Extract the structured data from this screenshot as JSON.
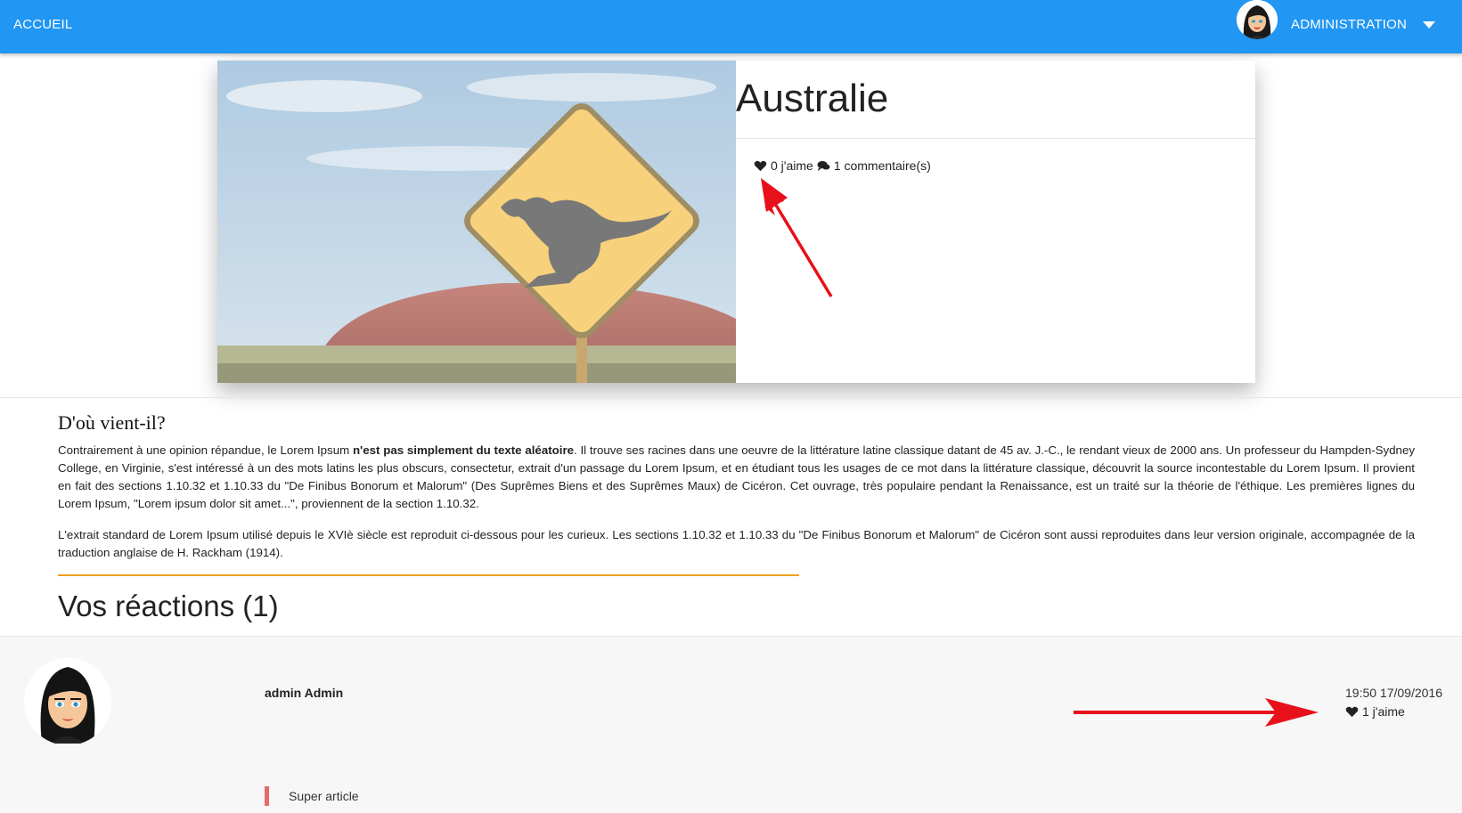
{
  "navbar": {
    "home_label": "ACCUEIL",
    "admin_label": "ADMINISTRATION"
  },
  "post": {
    "title": "Australie",
    "likes_label": "0 j'aime",
    "comments_label": "1 commentaire(s)"
  },
  "article": {
    "heading": "D'où vient-il?",
    "p1_before": "Contrairement à une opinion répandue, le Lorem Ipsum ",
    "p1_bold": "n'est pas simplement du texte aléatoire",
    "p1_after": ". Il trouve ses racines dans une oeuvre de la littérature latine classique datant de 45 av. J.-C., le rendant vieux de 2000 ans. Un professeur du Hampden-Sydney College, en Virginie, s'est intéressé à un des mots latins les plus obscurs, consectetur, extrait d'un passage du Lorem Ipsum, et en étudiant tous les usages de ce mot dans la littérature classique, découvrit la source incontestable du Lorem Ipsum. Il provient en fait des sections 1.10.32 et 1.10.33 du \"De Finibus Bonorum et Malorum\" (Des Suprêmes Biens et des Suprêmes Maux) de Cicéron. Cet ouvrage, très populaire pendant la Renaissance, est un traité sur la théorie de l'éthique. Les premières lignes du Lorem Ipsum, \"Lorem ipsum dolor sit amet...\", proviennent de la section 1.10.32.",
    "p2": "L'extrait standard de Lorem Ipsum utilisé depuis le XVIè siècle est reproduit ci-dessous pour les curieux. Les sections 1.10.32 et 1.10.33 du \"De Finibus Bonorum et Malorum\" de Cicéron sont aussi reproduites dans leur version originale, accompagnée de la traduction anglaise de H. Rackham (1914)."
  },
  "reactions": {
    "title": "Vos réactions (1)"
  },
  "comment": {
    "author": "admin Admin",
    "time": "19:50 17/09/2016",
    "likes_label": "1 j'aime",
    "text": "Super article"
  },
  "colors": {
    "navbar": "#2196f3",
    "accent_rule": "#f0a020",
    "quote_border": "#e86a6a",
    "annotation_arrow": "#e8101a"
  },
  "icons": [
    "user-avatar",
    "caret-down-icon",
    "heart-icon",
    "comments-icon"
  ]
}
